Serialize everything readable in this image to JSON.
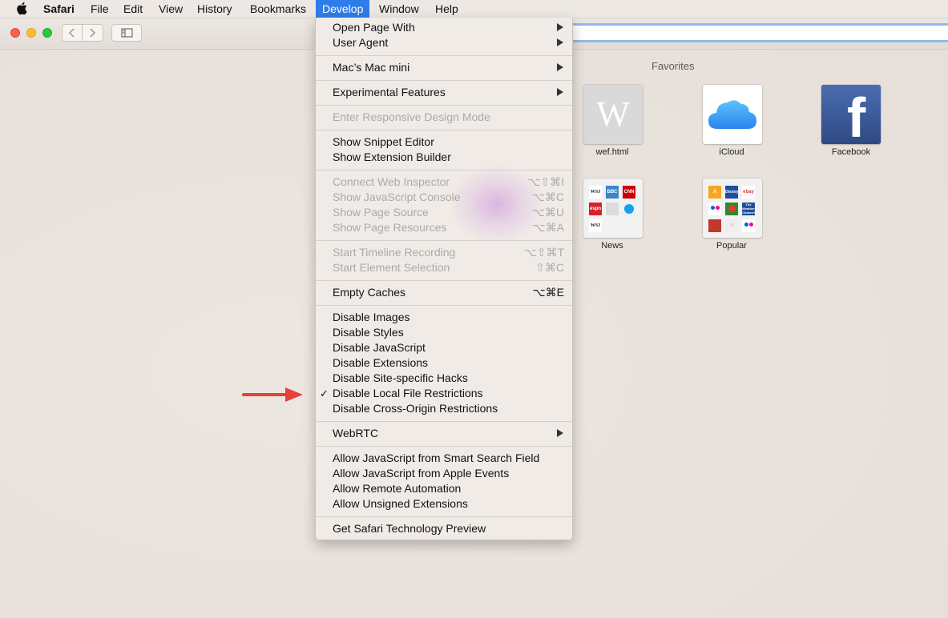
{
  "menubar": {
    "items": [
      {
        "label": "Safari"
      },
      {
        "label": "File"
      },
      {
        "label": "Edit"
      },
      {
        "label": "View"
      },
      {
        "label": "History"
      },
      {
        "label": "Bookmarks"
      },
      {
        "label": "Develop"
      },
      {
        "label": "Window"
      },
      {
        "label": "Help"
      }
    ]
  },
  "favorites": {
    "title": "Favorites",
    "tiles": [
      {
        "label": "wef.html",
        "glyph": "W"
      },
      {
        "label": "iCloud"
      },
      {
        "label": "Facebook",
        "glyph": "f"
      },
      {
        "label": "News"
      },
      {
        "label": "Popular"
      }
    ],
    "news_minis": [
      "WSJ",
      "BBC",
      "CNN",
      "espn",
      "",
      "",
      "WSJ"
    ],
    "popular_minis": [
      "A",
      "Disney",
      "ebay",
      "",
      "",
      "The Weather Channel",
      "",
      "",
      "",
      ""
    ]
  },
  "menu": {
    "items": [
      {
        "label": "Open Page With",
        "submenu": true
      },
      {
        "label": "User Agent",
        "submenu": true
      },
      {
        "label": "Mac’s Mac mini",
        "submenu": true
      },
      {
        "label": "Experimental Features",
        "submenu": true
      },
      {
        "label": "Enter Responsive Design Mode",
        "disabled": true
      },
      {
        "label": "Show Snippet Editor"
      },
      {
        "label": "Show Extension Builder"
      },
      {
        "label": "Connect Web Inspector",
        "shortcut": "⌥⇧⌘I",
        "disabled": true
      },
      {
        "label": "Show JavaScript Console",
        "shortcut": "⌥⌘C",
        "disabled": true
      },
      {
        "label": "Show Page Source",
        "shortcut": "⌥⌘U",
        "disabled": true
      },
      {
        "label": "Show Page Resources",
        "shortcut": "⌥⌘A",
        "disabled": true
      },
      {
        "label": "Start Timeline Recording",
        "shortcut": "⌥⇧⌘T",
        "disabled": true
      },
      {
        "label": "Start Element Selection",
        "shortcut": "⇧⌘C",
        "disabled": true
      },
      {
        "label": "Empty Caches",
        "shortcut": "⌥⌘E"
      },
      {
        "label": "Disable Images"
      },
      {
        "label": "Disable Styles"
      },
      {
        "label": "Disable JavaScript"
      },
      {
        "label": "Disable Extensions"
      },
      {
        "label": "Disable Site-specific Hacks"
      },
      {
        "label": "Disable Local File Restrictions",
        "checked": true,
        "check_mark": "✓"
      },
      {
        "label": "Disable Cross-Origin Restrictions"
      },
      {
        "label": "WebRTC",
        "submenu": true
      },
      {
        "label": "Allow JavaScript from Smart Search Field"
      },
      {
        "label": "Allow JavaScript from Apple Events"
      },
      {
        "label": "Allow Remote Automation"
      },
      {
        "label": "Allow Unsigned Extensions"
      },
      {
        "label": "Get Safari Technology Preview"
      }
    ]
  },
  "colors": {
    "menu_highlight": "#2f7ce8",
    "annotation_arrow": "#e8413a",
    "facebook_blue": "#3b5998",
    "icloud_blue": "#3d9cf3"
  },
  "icons": [
    "apple-icon",
    "back-icon",
    "forward-icon",
    "sidebar-icon",
    "icloud-icon",
    "facebook-icon",
    "submenu-arrow-icon",
    "checkmark-icon",
    "red-arrow-annotation"
  ]
}
